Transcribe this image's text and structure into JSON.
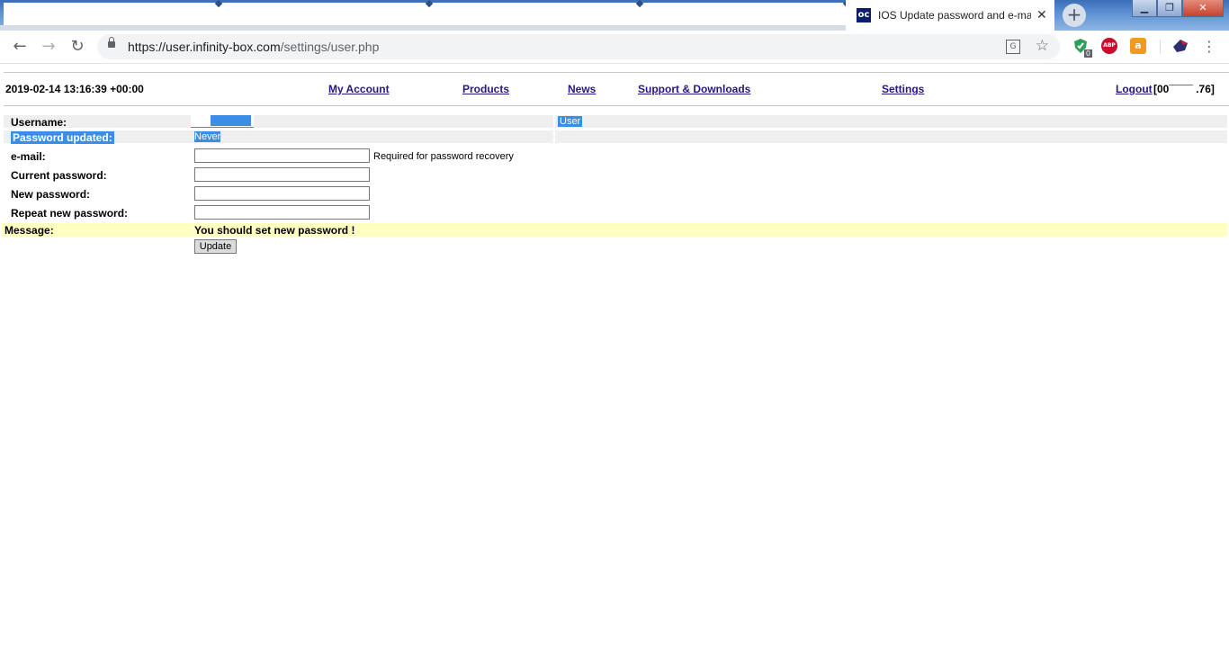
{
  "browser": {
    "active_tab_title": "IOS Update password and e-ma",
    "active_tab_favicon": "oc",
    "url_host": "https://user.infinity-box.com",
    "url_path": "/settings/user.php",
    "icons": {
      "back": "←",
      "forward": "→",
      "reload": "↻",
      "star": "☆",
      "menu": "⋮",
      "close_tab": "✕",
      "new_tab": "+",
      "translate": "G",
      "minimize": "▁",
      "restore": "❐",
      "close_window": "✕"
    },
    "extensions": {
      "counter_badge": "0",
      "abp_label": "ABP",
      "bag_label": "a"
    }
  },
  "header": {
    "datetime": "2019-02-14 13:16:39 +00:00",
    "menu": {
      "my_account": "My Account",
      "products": "Products",
      "news": "News",
      "support": "Support & Downloads",
      "settings": "Settings",
      "logout": "Logout"
    },
    "account_id": "[00¯¯¯¯    .76]"
  },
  "form": {
    "username_label": "Username:",
    "username_value": "",
    "user_type": "User",
    "password_updated_label": "Password updated:",
    "password_updated_value": "Never",
    "email_label": "e-mail:",
    "email_value": "",
    "email_hint": "Required for password recovery",
    "current_password_label": "Current password:",
    "new_password_label": "New password:",
    "repeat_password_label": "Repeat new password:",
    "message_label": "Message:",
    "message_text": "You should set new password !",
    "update_button": "Update"
  },
  "colors": {
    "link": "#2a1680",
    "selection": "#3a8ee6",
    "row_grey": "#efefef",
    "message_bg": "#ffffc0"
  }
}
